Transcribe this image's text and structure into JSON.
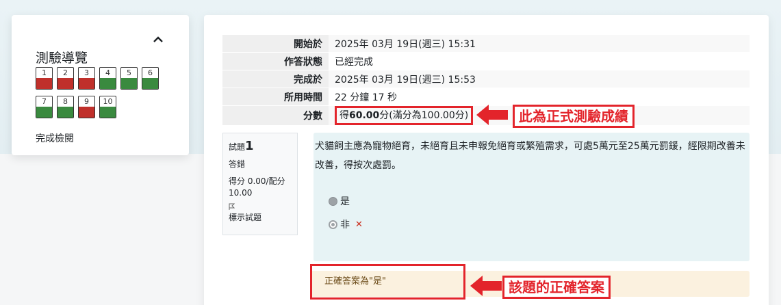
{
  "nav": {
    "title": "測驗導覽",
    "finish_review": "完成檢閱",
    "questions": [
      {
        "num": "1",
        "state": "incorrect"
      },
      {
        "num": "2",
        "state": "incorrect"
      },
      {
        "num": "3",
        "state": "incorrect"
      },
      {
        "num": "4",
        "state": "correct"
      },
      {
        "num": "5",
        "state": "correct"
      },
      {
        "num": "6",
        "state": "correct"
      },
      {
        "num": "7",
        "state": "correct"
      },
      {
        "num": "8",
        "state": "correct"
      },
      {
        "num": "9",
        "state": "incorrect"
      },
      {
        "num": "10",
        "state": "correct"
      }
    ]
  },
  "summary": {
    "rows": [
      {
        "label": "開始於",
        "value": "2025年 03月 19日(週三) 15:31"
      },
      {
        "label": "作答狀態",
        "value": "已經完成"
      },
      {
        "label": "完成於",
        "value": "2025年 03月 19日(週三) 15:53"
      },
      {
        "label": "所用時間",
        "value": "22 分鐘 17 秒"
      }
    ],
    "grade_label": "分數",
    "grade_prefix": "得",
    "grade_value": "60.00",
    "grade_suffix": "分(滿分為100.00分)"
  },
  "annotations": {
    "grade_note": "此為正式測驗成績",
    "answer_note": "該題的正確答案"
  },
  "question": {
    "prefix": "試題",
    "number": "1",
    "status": "答錯",
    "mark": "得分 0.00/配分 10.00",
    "flag_label": "標示試題",
    "text": "犬貓飼主應為寵物絕育，未絕育且未申報免絕育或繁殖需求，可處5萬元至25萬元罰鍰，經限期改善未改善，得按次處罰。",
    "options": [
      {
        "label": "是",
        "selected": false
      },
      {
        "label": "非",
        "selected": true,
        "feedback": "✕"
      }
    ],
    "right_answer": "正確答案為\"是\""
  },
  "colors": {
    "correct": "#3a8a3f",
    "incorrect": "#c0302b",
    "annotation_red": "#e3242b"
  }
}
